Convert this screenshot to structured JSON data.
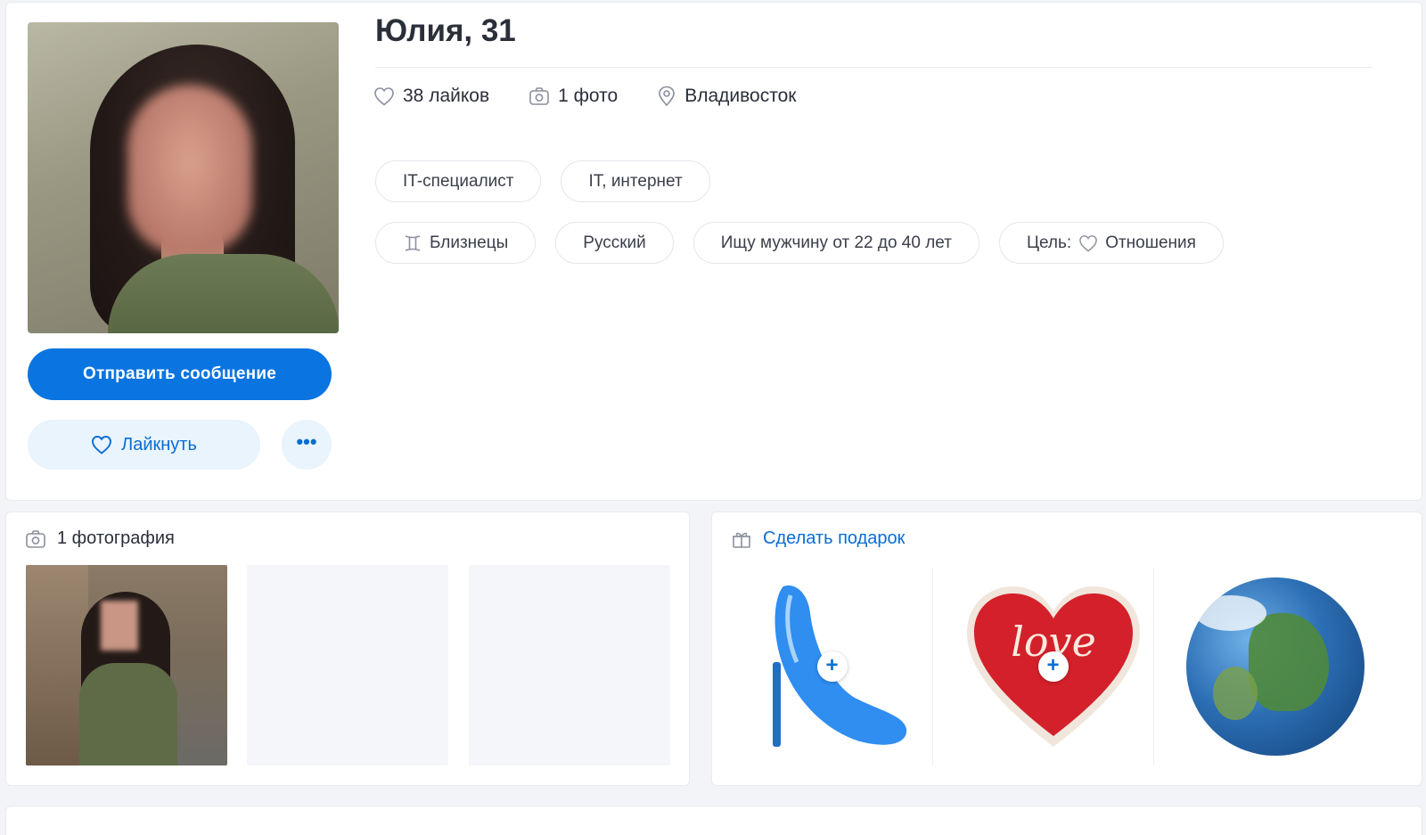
{
  "profile": {
    "name_age": "Юлия, 31",
    "stats": {
      "likes": "38 лайков",
      "photos": "1 фото",
      "city": "Владивосток"
    },
    "tags_row1": [
      "IT-специалист",
      "IT, интернет"
    ],
    "tags_row2": {
      "zodiac": "Близнецы",
      "language": "Русский",
      "looking_for": "Ищу мужчину от 22 до 40 лет",
      "goal_label": "Цель:",
      "goal_value": "Отношения"
    },
    "buttons": {
      "send_message": "Отправить сообщение",
      "like": "Лайкнуть",
      "more": "•••"
    }
  },
  "photos_section": {
    "title": "1 фотография"
  },
  "gifts_section": {
    "title": "Сделать подарок",
    "items": [
      {
        "icon": "high-heel-shoe-icon"
      },
      {
        "icon": "love-heart-icon",
        "text": "love"
      },
      {
        "icon": "globe-icon"
      }
    ],
    "add_symbol": "+"
  },
  "colors": {
    "accent": "#0a74e0",
    "accent_light": "#e9f4fd",
    "text": "#2b2f3a",
    "border": "#e3e6ea"
  }
}
